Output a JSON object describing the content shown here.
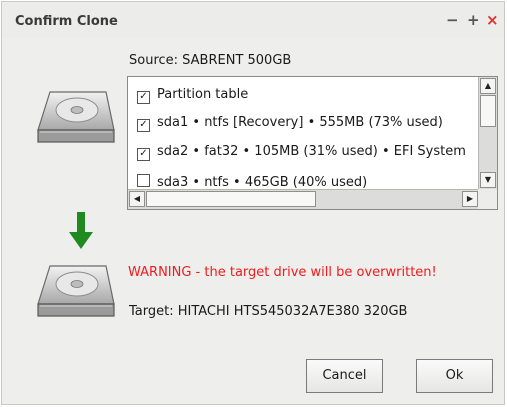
{
  "window": {
    "title": "Confirm Clone",
    "controls": {
      "minimize": "−",
      "maximize": "+",
      "close": "×"
    }
  },
  "source": {
    "label": "Source:  SABRENT 500GB"
  },
  "partitions": [
    {
      "checked": true,
      "label": "Partition table"
    },
    {
      "checked": true,
      "label": "sda1 • ntfs [Recovery] • 555MB (73% used)"
    },
    {
      "checked": true,
      "label": "sda2 • fat32 • 105MB (31% used) • EFI System"
    },
    {
      "checked": false,
      "label": "sda3 • ntfs • 465GB (40% used)"
    }
  ],
  "check_glyph": "✓",
  "scroll_glyphs": {
    "up": "▲",
    "down": "▼",
    "left": "◀",
    "right": "▶"
  },
  "warning": {
    "text": "WARNING - the target drive will be overwritten!",
    "color": "#ee1c1c"
  },
  "target": {
    "label": "Target:  HITACHI HTS545032A7E380 320GB"
  },
  "buttons": {
    "cancel": "Cancel",
    "ok": "Ok"
  },
  "icons": {
    "source_drive": "hard-drive-icon",
    "target_drive": "hard-drive-icon",
    "arrow": "arrow-down-icon",
    "arrow_color": "#1f8a1f"
  }
}
